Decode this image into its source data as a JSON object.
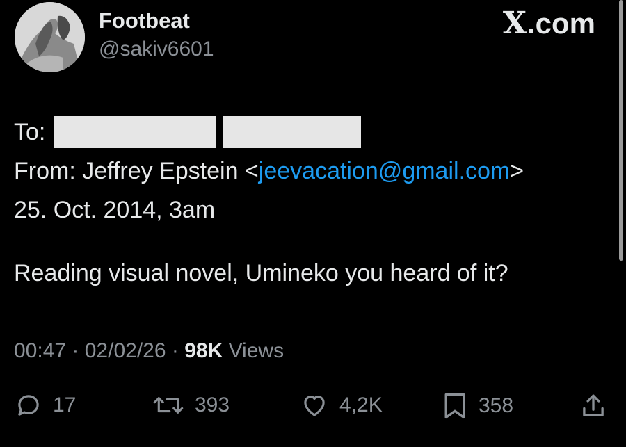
{
  "account": {
    "display_name": "Footbeat",
    "handle": "@sakiv6601"
  },
  "brand": {
    "x_glyph": "X",
    "text": ".com"
  },
  "email": {
    "to_label": "To:",
    "from_label": "From: Jeffrey Epstein <",
    "from_email": "jeevacation@gmail.com",
    "from_close": ">",
    "date": "25. Oct. 2014,  3am"
  },
  "post": {
    "text": "Reading visual novel, Umineko you heard of it?"
  },
  "meta": {
    "time": "00:47",
    "sep1": " · ",
    "date": "02/02/26",
    "sep2": " · ",
    "views_count": "98K",
    "views_label": " Views"
  },
  "actions": {
    "replies": "17",
    "reposts": "393",
    "likes": "4,2K",
    "bookmarks": "358"
  },
  "icons": [
    "reply-icon",
    "repost-icon",
    "like-icon",
    "bookmark-icon",
    "share-icon"
  ],
  "colors": {
    "background": "#000000",
    "text": "#e7e9ea",
    "muted": "#8b9096",
    "link": "#1d9bf0",
    "redaction": "#e6e6e6"
  }
}
